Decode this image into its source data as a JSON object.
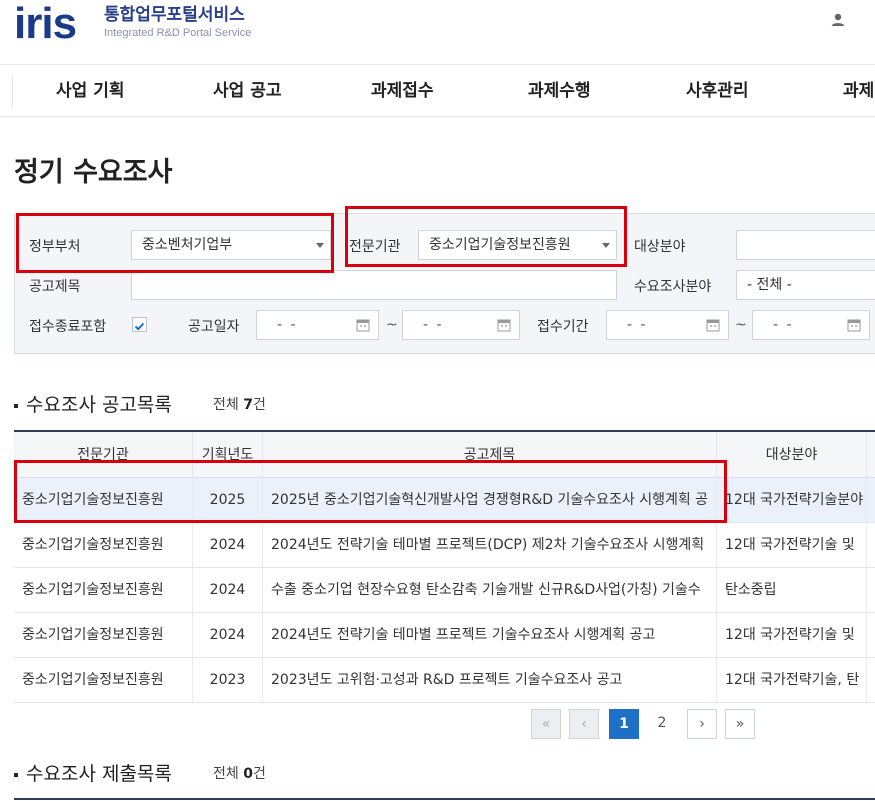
{
  "header": {
    "logo": "iris",
    "title": "통합업무포털서비스",
    "subtitle": "Integrated R&D Portal Service",
    "user_icon": "user-icon"
  },
  "gnb": [
    "사업 기획",
    "사업 공고",
    "과제접수",
    "과제수행",
    "사후관리",
    "과제"
  ],
  "page_title": "정기 수요조사",
  "search": {
    "ministry_label": "정부부처",
    "ministry_value": "중소벤처기업부",
    "agency_label": "전문기관",
    "agency_value": "중소기업기술정보진흥원",
    "target_label": "대상분야",
    "title_label": "공고제목",
    "survey_field_label": "수요조사분야",
    "survey_field_value": "- 전체 -",
    "include_closed_label": "접수종료포함",
    "notice_date_label": "공고일자",
    "receipt_period_label": "접수기간",
    "date_placeholder": "- -",
    "tilde": "~"
  },
  "list1": {
    "title": "수요조사 공고목록",
    "count_prefix": "전체 ",
    "count": "7",
    "count_suffix": "건",
    "columns": [
      "전문기관",
      "기획년도",
      "공고제목",
      "대상분야"
    ],
    "rows": [
      {
        "agency": "중소기업기술정보진흥원",
        "year": "2025",
        "title": "2025년 중소기업기술혁신개발사업 경쟁형R&D 기술수요조사 시행계획 공",
        "field": "12대 국가전략기술분야"
      },
      {
        "agency": "중소기업기술정보진흥원",
        "year": "2024",
        "title": "2024년도 전략기술 테마별 프로젝트(DCP) 제2차 기술수요조사 시행계획",
        "field": "12대 국가전략기술 및"
      },
      {
        "agency": "중소기업기술정보진흥원",
        "year": "2024",
        "title": "수출 중소기업 현장수요형 탄소감축 기술개발 신규R&D사업(가칭) 기술수",
        "field": "탄소중립"
      },
      {
        "agency": "중소기업기술정보진흥원",
        "year": "2024",
        "title": "2024년도 전략기술 테마별 프로젝트 기술수요조사 시행계획 공고",
        "field": "12대 국가전략기술 및"
      },
      {
        "agency": "중소기업기술정보진흥원",
        "year": "2023",
        "title": "2023년도 고위험·고성과 R&D 프로젝트 기술수요조사 공고",
        "field": "12대 국가전략기술, 탄"
      }
    ]
  },
  "pagination": {
    "first": "«",
    "prev": "‹",
    "pages": [
      "1",
      "2"
    ],
    "next": "›",
    "last": "»"
  },
  "list2": {
    "title": "수요조사 제출목록",
    "count_prefix": "전체 ",
    "count": "0",
    "count_suffix": "건"
  },
  "colors": {
    "highlight": "#d9000d",
    "accent": "#1e6fc8",
    "brand": "#1a3a8a"
  }
}
